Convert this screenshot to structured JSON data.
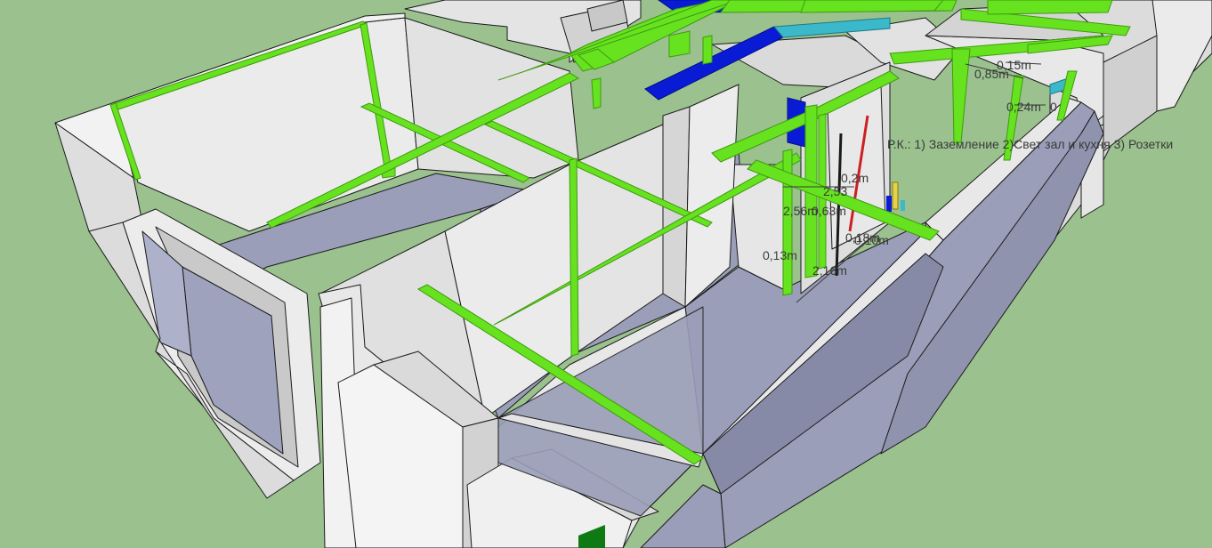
{
  "scene": {
    "colors": {
      "ground": "#9ac18e",
      "wall_light": "#ebebeb",
      "wall_mid": "#d6d6d6",
      "wall_shadow": "#c4c4c4",
      "floor": "#9a9eb8",
      "floor_dark": "#868aa6",
      "cable": "#66e21f",
      "cable_edge": "#3f9a10",
      "duct_blue": "#0a1bd6",
      "pipe_cyan": "#3bb8c9",
      "pipe_red": "#cc2020",
      "pipe_yellow": "#e6d24a",
      "dimension": "#3a3a3a"
    },
    "icons": [
      "ground-plane",
      "wall-block",
      "floor-slab",
      "cable-tray",
      "duct",
      "pipe",
      "dimension-arrow"
    ]
  },
  "annotations": {
    "note": "Р.К.: 1) Заземление 2)Свет зал и кухня 3) Розетки",
    "dims": {
      "d_0_15": "0,15m",
      "d_0_85": "0,85m",
      "d_0_24": "0,24m",
      "d_0_24_tail": "0",
      "d_0_2": "0,2m",
      "d_2_53": "2,53",
      "d_2_56": "2,56m",
      "d_0_63": "0,63m",
      "d_0_18": "0,18m",
      "d_0_10": "0,10m",
      "d_0_13": "0,13m",
      "d_2_16": "2,16m"
    }
  }
}
